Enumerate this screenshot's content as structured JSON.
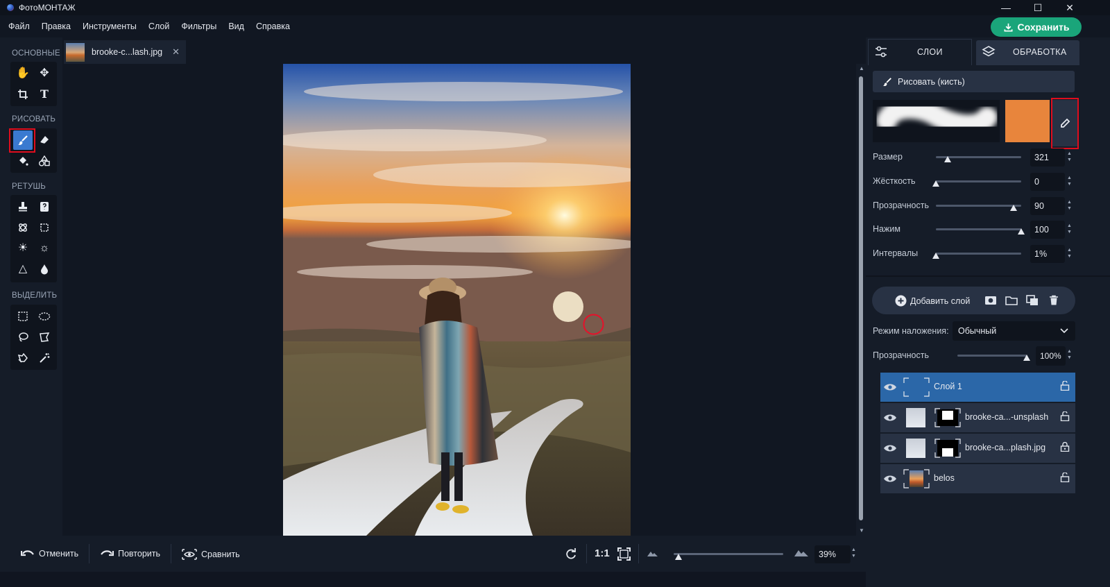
{
  "app": {
    "title": "ФотоМОНТАЖ"
  },
  "window": {
    "minimize": "—",
    "maximize": "☐",
    "close": "✕"
  },
  "menu": [
    "Файл",
    "Правка",
    "Инструменты",
    "Слой",
    "Фильтры",
    "Вид",
    "Справка"
  ],
  "save_button": "Сохранить",
  "tools": {
    "sections": [
      "ОСНОВНЫЕ",
      "РИСОВАТЬ",
      "РЕТУШЬ",
      "ВЫДЕЛИТЬ"
    ]
  },
  "document_tab": {
    "label": "brooke-c...lash.jpg",
    "close": "✕"
  },
  "bottom": {
    "undo": "Отменить",
    "redo": "Повторить",
    "compare": "Сравнить",
    "one_to_one": "1:1",
    "zoom_value": "39%",
    "zoom_level": 0.01
  },
  "right_tabs": {
    "layers": "СЛОИ",
    "processing": "ОБРАБОТКА"
  },
  "brush": {
    "mode_label": "Рисовать (кисть)",
    "color": "#e8853c",
    "params": [
      {
        "label": "Размер",
        "value": "321",
        "level": 0.14
      },
      {
        "label": "Жёсткость",
        "value": "0",
        "level": 0.0
      },
      {
        "label": "Прозрачность",
        "value": "90",
        "level": 0.91
      },
      {
        "label": "Нажим",
        "value": "100",
        "level": 1.0
      },
      {
        "label": "Интервалы",
        "value": "1%",
        "level": 0.0
      }
    ]
  },
  "layers_panel": {
    "add_layer": "Добавить слой",
    "blend_label": "Режим наложения:",
    "blend_value": "Обычный",
    "opacity_label": "Прозрачность",
    "opacity_value": "100%",
    "opacity_level": 1.0,
    "layers": [
      {
        "name": "Слой 1",
        "selected": true,
        "locked": false
      },
      {
        "name": "brooke-ca...-unsplash",
        "selected": false,
        "locked": false
      },
      {
        "name": "brooke-ca...plash.jpg",
        "selected": false,
        "locked": true
      },
      {
        "name": "belos",
        "selected": false,
        "locked": false
      }
    ]
  }
}
